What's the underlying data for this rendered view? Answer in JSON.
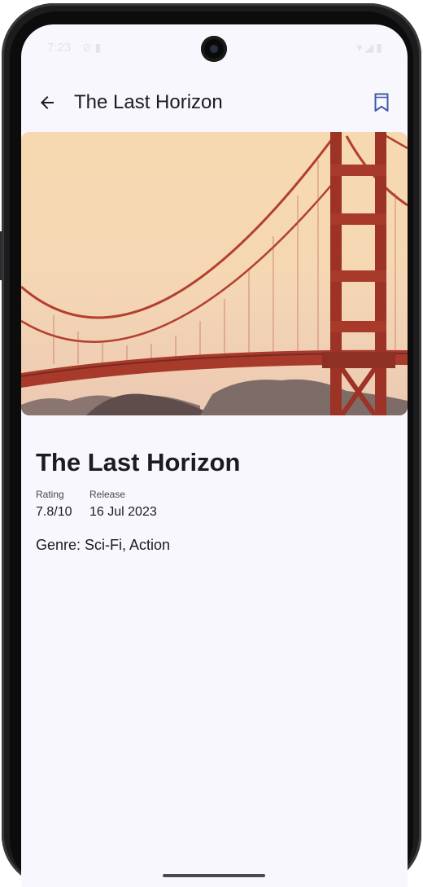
{
  "status_bar": {
    "time": "7:23",
    "left_icons": "⊘ ▮",
    "right_icons": "▾◢▮"
  },
  "app_bar": {
    "title": "The Last Horizon",
    "back_icon": "arrow-back-icon",
    "bookmark_icon": "bookmark-icon"
  },
  "movie": {
    "poster_icon": "golden-gate-bridge-image",
    "title": "The Last Horizon",
    "rating_label": "Rating",
    "rating_value": "7.8/10",
    "release_label": "Release",
    "release_value": "16 Jul 2023",
    "genre": "Genre: Sci-Fi, Action"
  },
  "colors": {
    "background": "#f8f7fd",
    "text_primary": "#1b1b21",
    "accent": "#3f5aa8",
    "bridge": "#b23a2c"
  }
}
